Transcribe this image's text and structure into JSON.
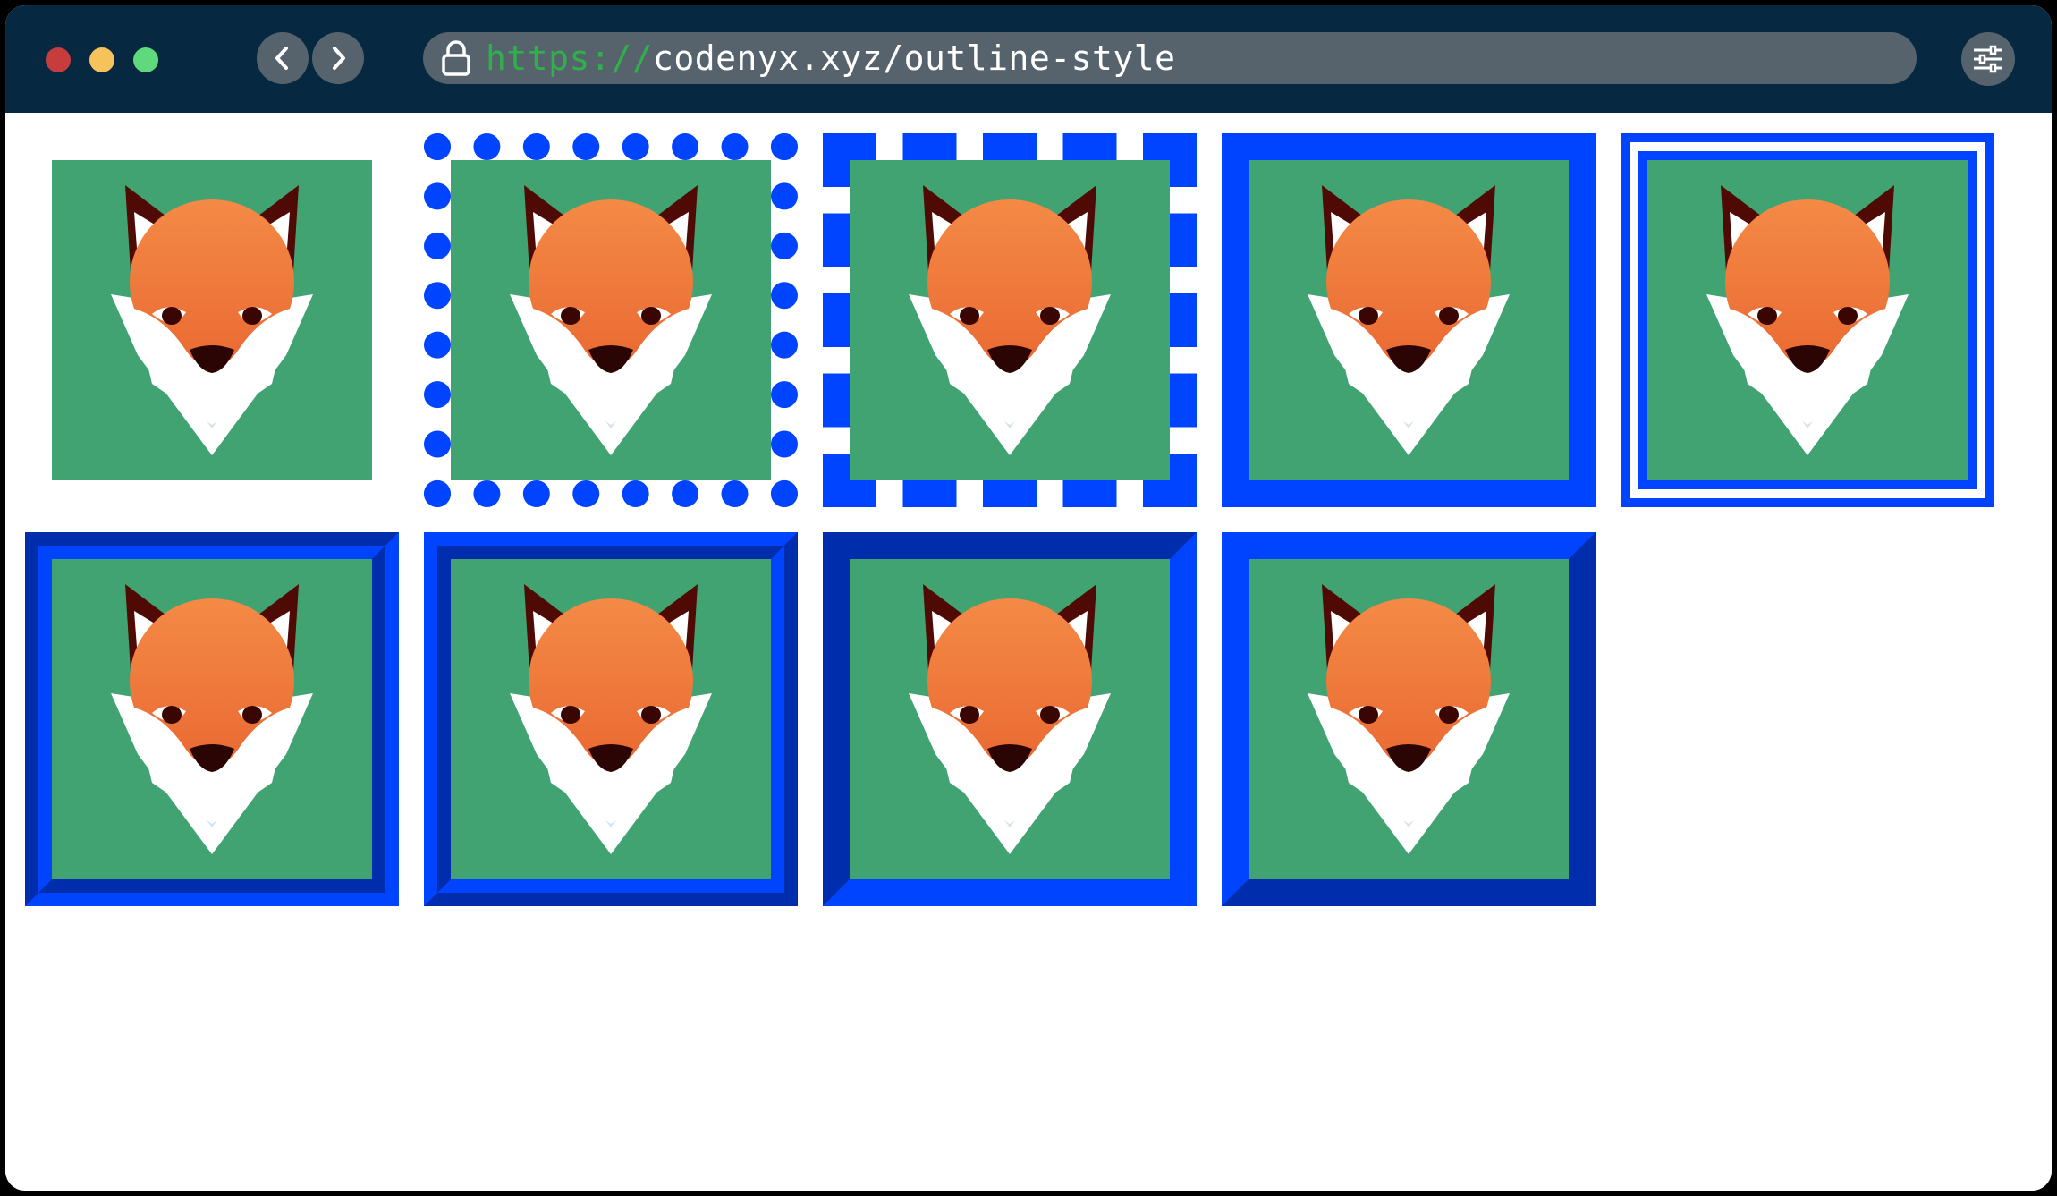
{
  "browser": {
    "url_scheme": "https://",
    "url_rest": "codenyx.xyz/outline-style",
    "buttons": {
      "close": "close-window",
      "minimize": "minimize-window",
      "maximize": "maximize-window",
      "back": "back",
      "forward": "forward",
      "menu": "settings"
    },
    "icons": [
      "lock-icon",
      "chevron-left-icon",
      "chevron-right-icon",
      "sliders-icon"
    ],
    "colors": {
      "toolbar": "#062840",
      "control": "#56636d",
      "close": "#c73d3d",
      "minimize": "#f5c25b",
      "maximize": "#5fd97c",
      "scheme": "#2fb04a"
    }
  },
  "page": {
    "images": [
      {
        "alt": "fox",
        "outline_style": "none"
      },
      {
        "alt": "fox",
        "outline_style": "dotted"
      },
      {
        "alt": "fox",
        "outline_style": "dashed"
      },
      {
        "alt": "fox",
        "outline_style": "solid"
      },
      {
        "alt": "fox",
        "outline_style": "double"
      },
      {
        "alt": "fox",
        "outline_style": "groove"
      },
      {
        "alt": "fox",
        "outline_style": "ridge"
      },
      {
        "alt": "fox",
        "outline_style": "inset"
      },
      {
        "alt": "fox",
        "outline_style": "outset"
      }
    ],
    "outline_color": "#0044ff",
    "image_background": "#41a372"
  }
}
